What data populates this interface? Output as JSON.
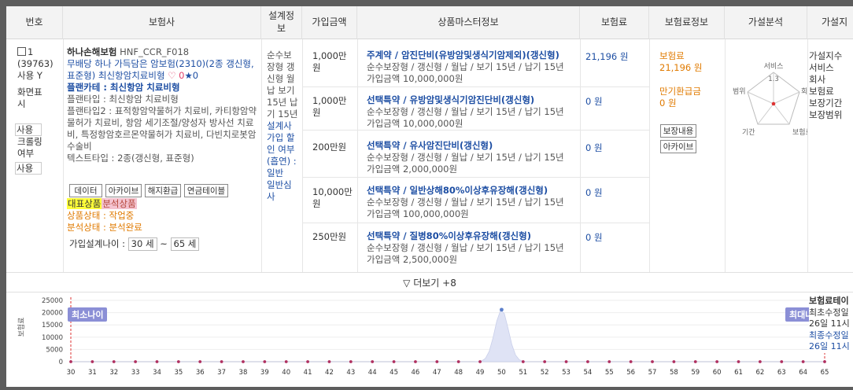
{
  "columns": {
    "num": "번호",
    "insurer": "보험사",
    "design": "설계정보",
    "amount": "가입금액",
    "master": "상품마스터정보",
    "premium": "보험료",
    "premium_info": "보험료정보",
    "analysis": "가설분석",
    "analysis2": "가설지"
  },
  "row": {
    "index": "1",
    "id": "(39763)",
    "use_label": "사용 Y",
    "screen_label": "화면표시",
    "screen_value": "사용",
    "crawl_label": "크롤링여부",
    "crawl_value": "사용",
    "company": "하나손해보험",
    "code": "HNF_CCR_F018",
    "product_name": "무배당 하나 가득담은 암보험(2310)(2종 갱신형, 표준형) 최신항암치료비형",
    "heart": "♡ 0",
    "star": "★0",
    "plan_card": "플랜카테 : 최신항암 치료비형",
    "plan_type1": "플랜타입 : 최신항암 치료비형",
    "plan_type2": "플랜타입2 : 표적항암약물허가 치료비, 카티항암약물허가 치료비, 항암 세기조절/양성자 방사선 치료비, 특정항암호르몬약물허가 치료비, 다빈치로봇암수술비",
    "text_type": "텍스트타입 : 2종(갱신형, 표준형)",
    "btn_data": "데이터",
    "btn_archive": "아카이브",
    "btn_refund": "해지환급",
    "btn_annuity": "연금테이블",
    "tag_rep": "대표상품",
    "tag_analysis": "분석상품",
    "status_product": "상품상태 : 작업중",
    "status_analysis": "분석상태 : 분석완료",
    "age_label": "가입설계나이 :",
    "age_min": "30 세",
    "age_sep": "~",
    "age_max": "65 세",
    "design_text1": "순수보장형 갱신형 월납 보기 15년 납기 15년",
    "design_text2": "설계사 가입 할인 여부(흡연) : 일반",
    "design_text3": "일반심사"
  },
  "products": [
    {
      "amount": "1,000만원",
      "title": "주계약 / 암진단비(유방암및생식기암제외)(갱신형)",
      "line2": "순수보장형 / 갱신형 / 월납 / 보기 15년 / 납기 15년",
      "line3": "가입금액 10,000,000원",
      "premium": "21,196 원"
    },
    {
      "amount": "1,000만원",
      "title": "선택특약 / 유방암및생식기암진단비(갱신형)",
      "line2": "순수보장형 / 갱신형 / 월납 / 보기 15년 / 납기 15년",
      "line3": "가입금액 10,000,000원",
      "premium": "0 원"
    },
    {
      "amount": "200만원",
      "title": "선택특약 / 유사암진단비(갱신형)",
      "line2": "순수보장형 / 갱신형 / 월납 / 보기 15년 / 납기 15년",
      "line3": "가입금액 2,000,000원",
      "premium": "0 원"
    },
    {
      "amount": "10,000만원",
      "title": "선택특약 / 일반상해80%이상후유장해(갱신형)",
      "line2": "순수보장형 / 갱신형 / 월납 / 보기 15년 / 납기 15년",
      "line3": "가입금액 100,000,000원",
      "premium": "0 원"
    },
    {
      "amount": "250만원",
      "title": "선택특약 / 질병80%이상후유장해(갱신형)",
      "line2": "순수보장형 / 갱신형 / 월납 / 보기 15년 / 납기 15년",
      "line3": "가입금액 2,500,000원",
      "premium": "0 원"
    }
  ],
  "premium_info": {
    "label1": "보험료",
    "value1": "21,196 원",
    "label2": "만기환급금",
    "value2": "0 원",
    "btn_coverage": "보장내용",
    "btn_archive": "아카이브"
  },
  "radar": {
    "labels": [
      "서비스",
      "회사",
      "보험료",
      "기간",
      "범위"
    ],
    "center_value": "1.3"
  },
  "analysis2": [
    "가설지수",
    "서비스",
    "회사",
    "보험료",
    "보장기간",
    "보장범위"
  ],
  "more_label": "▽ 더보기 +8",
  "chart_side": [
    "보험료테이",
    "최초수정일",
    "26일 11시",
    "최종수정일",
    "26일 11시"
  ],
  "chart_data": {
    "type": "area",
    "ylabel": "보험료",
    "ylim": [
      0,
      25000
    ],
    "y_ticks": [
      "25000",
      "20000",
      "15000",
      "10000",
      "5000",
      "0"
    ],
    "x": [
      30,
      31,
      32,
      33,
      34,
      35,
      36,
      37,
      38,
      39,
      40,
      41,
      42,
      43,
      44,
      45,
      46,
      47,
      48,
      49,
      50,
      51,
      52,
      53,
      54,
      55,
      56,
      57,
      58,
      59,
      60,
      61,
      62,
      63,
      64,
      65
    ],
    "values": [
      0,
      0,
      0,
      0,
      0,
      0,
      0,
      0,
      0,
      0,
      0,
      0,
      0,
      0,
      0,
      0,
      0,
      0,
      0,
      0,
      21196,
      0,
      0,
      0,
      0,
      0,
      0,
      0,
      0,
      0,
      0,
      0,
      0,
      0,
      0,
      0
    ],
    "min_label": "최소나이",
    "max_label": "최대나이",
    "colors": {
      "fill": "#dfe3f5",
      "point": "#5b7fcb",
      "zero_point": "#b03060",
      "marker": "#d33"
    }
  }
}
